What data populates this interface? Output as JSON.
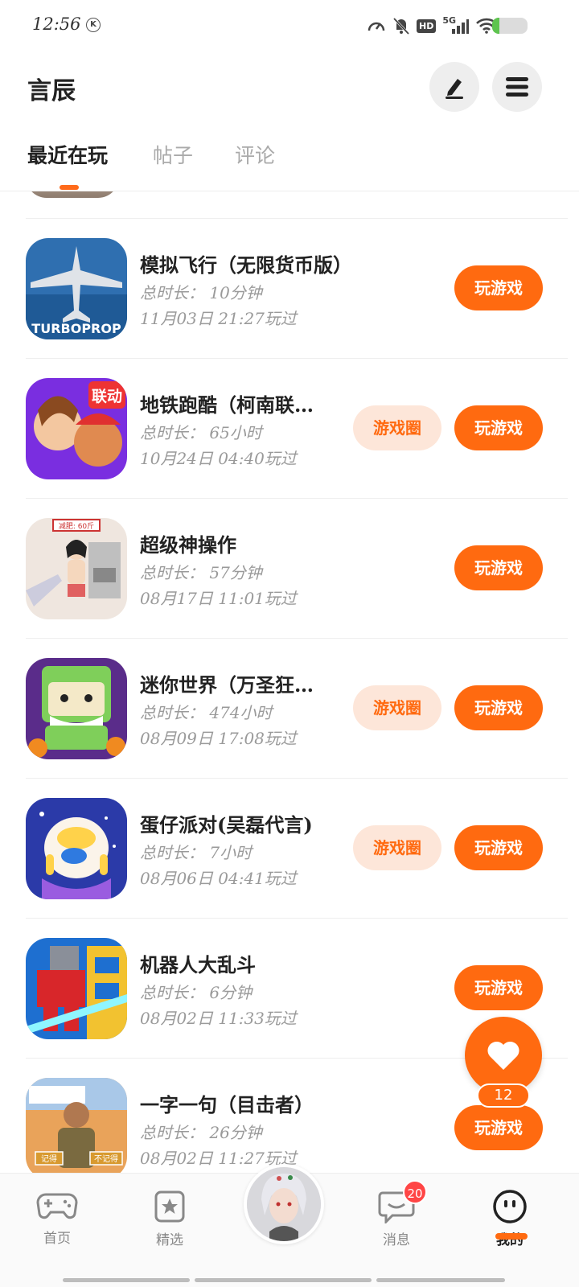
{
  "status_bar": {
    "time": "12:56",
    "k_icon": "K",
    "network": "5G",
    "hd": "HD",
    "battery_level": 0.2
  },
  "header": {
    "title": "言辰"
  },
  "tabs": [
    {
      "label": "最近在玩",
      "active": true
    },
    {
      "label": "帖子",
      "active": false
    },
    {
      "label": "评论",
      "active": false
    }
  ],
  "games": [
    {
      "name": "模拟飞行（无限货币版）",
      "duration": "总时长：  10分钟",
      "last_played": "11月03日  21:27玩过",
      "has_circle": false,
      "thumb_text": "TURBOPROP"
    },
    {
      "name": "地铁跑酷（柯南联…",
      "duration": "总时长：  65小时",
      "last_played": "10月24日  04:40玩过",
      "has_circle": true,
      "thumb_text": "联动"
    },
    {
      "name": "超级神操作",
      "duration": "总时长：  57分钟",
      "last_played": "08月17日  11:01玩过",
      "has_circle": false,
      "thumb_text": "减肥: 60斤"
    },
    {
      "name": "迷你世界（万圣狂…",
      "duration": "总时长：  474小时",
      "last_played": "08月09日  17:08玩过",
      "has_circle": true
    },
    {
      "name": "蛋仔派对(吴磊代言)",
      "duration": "总时长：  7小时",
      "last_played": "08月06日  04:41玩过",
      "has_circle": true
    },
    {
      "name": "机器人大乱斗",
      "duration": "总时长：  6分钟",
      "last_played": "08月02日  11:33玩过",
      "has_circle": false
    },
    {
      "name": "一字一句（目击者）",
      "duration": "总时长：  26分钟",
      "last_played": "08月02日  11:27玩过",
      "has_circle": false,
      "thumb_text": "记得",
      "thumb_text2": "不记得"
    }
  ],
  "buttons": {
    "play": "玩游戏",
    "circle": "游戏圈"
  },
  "fab": {
    "count": "12"
  },
  "bottom_nav": {
    "home": "首页",
    "select": "精选",
    "msg": "消息",
    "msg_badge": "20",
    "mine": "我的"
  },
  "colors": {
    "accent": "#ff6a10",
    "accent_light": "#fde6d9",
    "badge": "#ff4545"
  }
}
